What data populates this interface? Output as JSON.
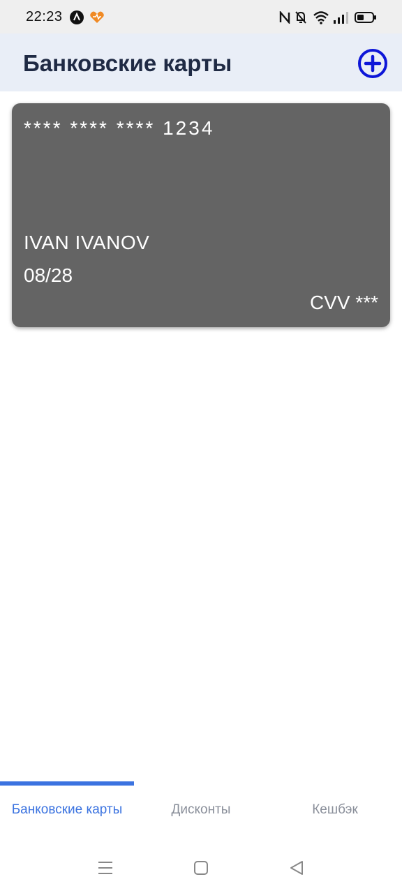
{
  "status_bar": {
    "time": "22:23",
    "icons": [
      "app-a-icon",
      "heart-app-icon",
      "nfc-icon",
      "bell-muted-icon",
      "wifi-icon",
      "signal-icon",
      "battery-icon"
    ]
  },
  "header": {
    "title": "Банковские карты",
    "add_icon": "add-circle-icon",
    "accent_color": "#0d16d8"
  },
  "card": {
    "number": "**** **** **** 1234",
    "holder": "IVAN IVANOV",
    "expiry": "08/28",
    "cvv": "CVV ***",
    "background_color": "#646464"
  },
  "tabs": {
    "items": [
      {
        "label": "Банковские карты",
        "active": true
      },
      {
        "label": "Дисконты",
        "active": false
      },
      {
        "label": "Кешбэк",
        "active": false
      }
    ],
    "active_color": "#3b73e0",
    "inactive_color": "#8a8f9a"
  },
  "system_nav": {
    "icons": [
      "menu-icon",
      "home-square-icon",
      "back-triangle-icon"
    ]
  }
}
